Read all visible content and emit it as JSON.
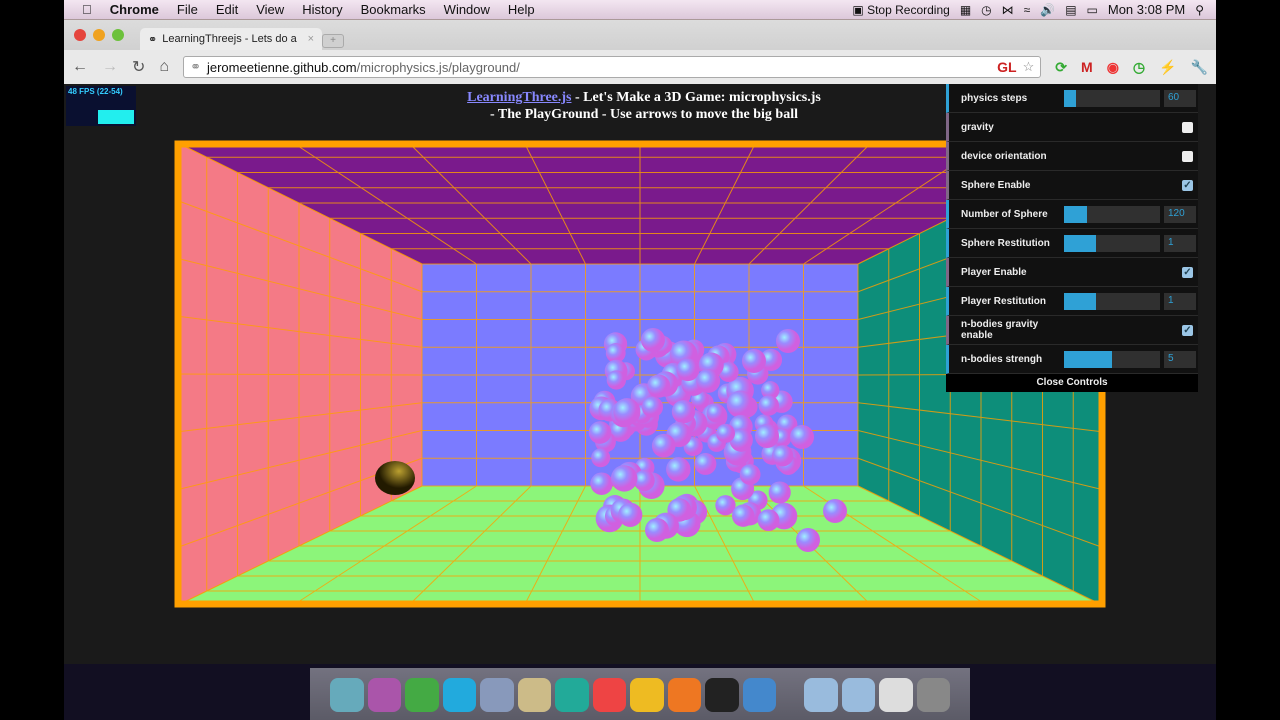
{
  "menubar": {
    "app": "Chrome",
    "items": [
      "File",
      "Edit",
      "View",
      "History",
      "Bookmarks",
      "Window",
      "Help"
    ],
    "recording": "Stop Recording",
    "clock": "Mon 3:08 PM"
  },
  "browser": {
    "tab_title": "LearningThreejs - Lets do a",
    "url_host": "jeromeetienne.github.com",
    "url_path": "/microphysics.js/playground/",
    "ext_gl": "GL"
  },
  "page": {
    "fps": "48 FPS (22-54)",
    "title_link": "LearningThree.js",
    "title_rest": " - Let's Make a 3D Game: microphysics.js",
    "subtitle": "- The PlayGround - Use arrows to move the big ball"
  },
  "controls": {
    "rows": [
      {
        "label": "physics steps",
        "type": "number",
        "value": "60",
        "fill": 0.12
      },
      {
        "label": "gravity",
        "type": "bool",
        "checked": false
      },
      {
        "label": "device orientation",
        "type": "bool",
        "checked": false
      },
      {
        "label": "Sphere Enable",
        "type": "bool",
        "checked": true
      },
      {
        "label": "Number of Sphere",
        "type": "number",
        "value": "120",
        "fill": 0.24
      },
      {
        "label": "Sphere Restitution",
        "type": "number",
        "value": "1",
        "fill": 0.33
      },
      {
        "label": "Player Enable",
        "type": "bool",
        "checked": true
      },
      {
        "label": "Player Restitution",
        "type": "number",
        "value": "1",
        "fill": 0.33
      },
      {
        "label": "n-bodies gravity enable",
        "type": "bool",
        "checked": true
      },
      {
        "label": "n-bodies strengh",
        "type": "number",
        "value": "5",
        "fill": 0.5
      }
    ],
    "close_label": "Close Controls"
  },
  "colors": {
    "frame": "#ffa000",
    "left_wall": "#f47a86",
    "ceiling": "#7a1a8c",
    "back_wall": "#7b7bff",
    "right_wall": "#0d8e7a",
    "floor": "#8cf57a",
    "slider": "#2fa1d6"
  },
  "dock": [
    "finder-icon",
    "tor-icon",
    "adium-icon",
    "skype-icon",
    "safari-icon",
    "safari-icon",
    "camino-icon",
    "chrome-icon",
    "chrome-canary-icon",
    "firefox-icon",
    "terminal-icon",
    "quicktime-icon",
    "applications-folder-icon",
    "documents-folder-icon",
    "preview-icon",
    "trash-icon"
  ]
}
